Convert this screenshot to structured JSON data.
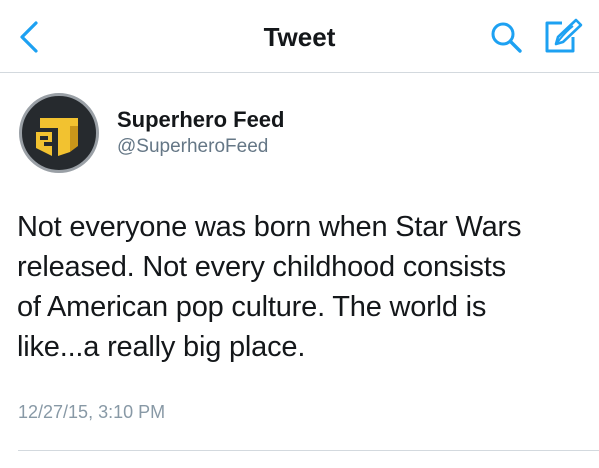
{
  "nav": {
    "title": "Tweet",
    "back_icon": "chevron-left-icon",
    "search_icon": "search-icon",
    "compose_icon": "compose-tweet-icon",
    "accent_color": "#1da1f2"
  },
  "tweet": {
    "author": {
      "display_name": "Superhero Feed",
      "handle": "@SuperheroFeed",
      "avatar_icon": "superhero-feed-logo"
    },
    "text_lines": [
      "Not everyone was born when Star Wars",
      "released. Not every childhood consists",
      "of American pop culture. The world is",
      "like...a really big place."
    ],
    "timestamp": "12/27/15, 3:10 PM"
  }
}
